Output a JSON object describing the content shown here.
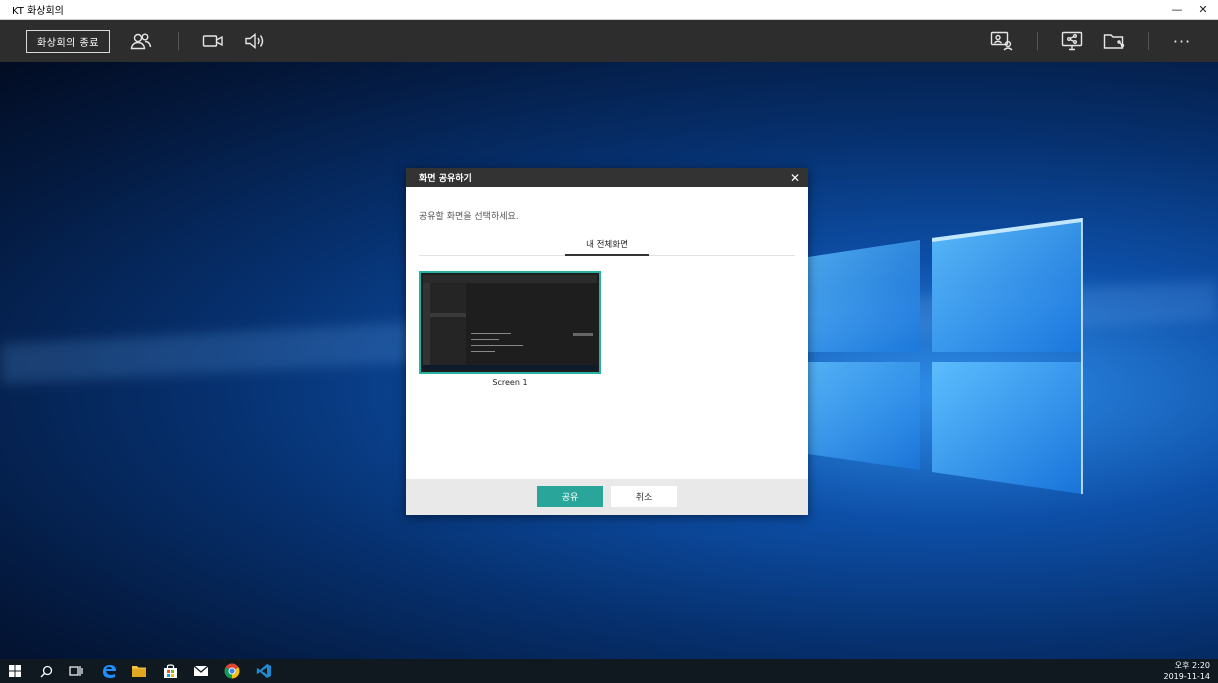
{
  "window": {
    "title": "KT 화상회의",
    "minimize": "—",
    "close": "✕"
  },
  "toolbar": {
    "end_meeting_label": "화상회의 종료",
    "more_label": "···"
  },
  "dialog": {
    "title": "화면 공유하기",
    "close": "✕",
    "prompt": "공유할 화면을 선택하세요.",
    "tab_label": "내 전체화면",
    "screens": [
      {
        "label": "Screen 1",
        "selected": true
      }
    ],
    "share_button": "공유",
    "cancel_button": "취소"
  },
  "taskbar": {
    "clock_time": "오후 2:20",
    "clock_date": "2019-11-14"
  },
  "colors": {
    "accent": "#2aa59a",
    "toolbar": "#2d2d2d",
    "dialog_header": "#333333"
  }
}
